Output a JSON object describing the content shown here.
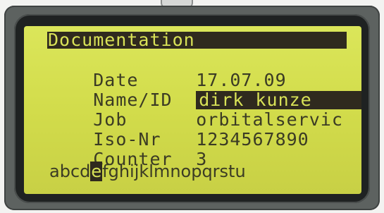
{
  "screen": {
    "title": "Documentation",
    "fields": [
      {
        "label": "Date",
        "value": "17.07.09"
      },
      {
        "label": "Name/ID",
        "value": "dirk kunze"
      },
      {
        "label": "Job",
        "value": "orbitalservic"
      },
      {
        "label": "Iso-Nr",
        "value": "1234567890"
      },
      {
        "label": "Counter",
        "value": "3"
      }
    ],
    "alphabet": {
      "before": "abcd",
      "selected": "e",
      "after": "fghijklmnopqrstu"
    }
  },
  "colors": {
    "lcd_background": "#d2dc4b",
    "lcd_text": "#3b3b24",
    "inverse_background": "#2f2a1e"
  }
}
